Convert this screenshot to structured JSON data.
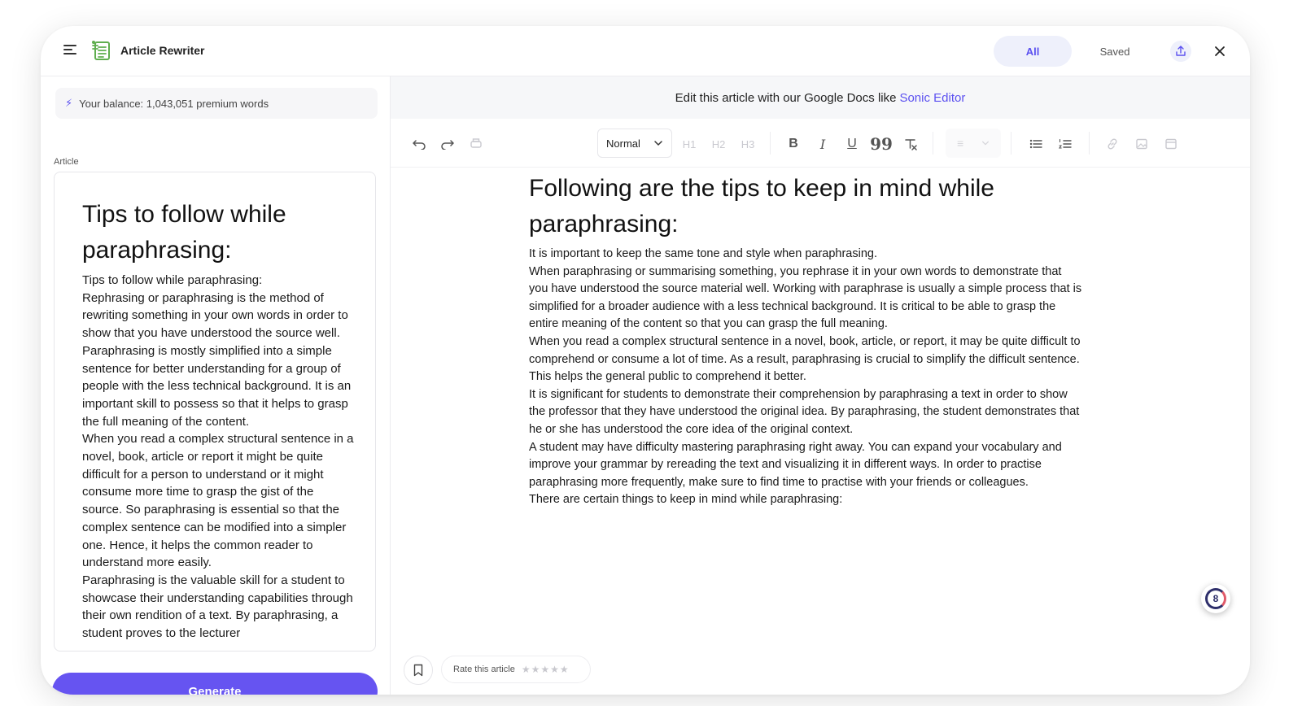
{
  "header": {
    "app_title": "Article Rewriter",
    "tabs": [
      {
        "label": "All",
        "active": true
      },
      {
        "label": "Saved",
        "active": false
      }
    ],
    "icons": [
      "menu-icon",
      "logo-icon",
      "share-icon",
      "close-icon"
    ]
  },
  "left": {
    "balance": "Your balance: 1,043,051 premium words",
    "article_label": "Article",
    "article": {
      "title": "Tips to follow while paraphrasing:",
      "paragraphs": [
        "Tips to follow while paraphrasing:",
        "Rephrasing or paraphrasing is the method of rewriting something in your own words in order to show that you have understood the source well. Paraphrasing is mostly simplified into a simple sentence for better understanding for a group of people with the less technical background. It is an important skill to possess so that it helps to grasp the full meaning of the content.",
        "When you read a complex structural sentence in a novel, book, article or report it might be quite difficult for a person to understand or it might consume more time to grasp the gist of the source. So paraphrasing is essential so that the complex sentence can be modified into a simpler one. Hence, it helps the common reader to understand more easily.",
        "Paraphrasing is the valuable skill for a student to showcase their understanding capabilities through their own rendition of a text. By paraphrasing, a student proves to the lecturer"
      ]
    },
    "generate_label": "Generate"
  },
  "editor": {
    "promo_text": "Edit this article with our Google Docs like",
    "promo_link": "Sonic Editor",
    "toolbar": {
      "style_value": "Normal",
      "h1": "H1",
      "h2": "H2",
      "h3": "H3"
    },
    "document": {
      "title": "Following are the tips to keep in mind while paraphrasing:",
      "paragraphs": [
        "It is important to keep the same tone and style when paraphrasing.",
        "When paraphrasing or summarising something, you rephrase it in your own words to demonstrate that you have understood the source material well. Working with paraphrase is usually a simple process that is simplified for a broader audience with a less technical background. It is critical to be able to grasp the entire meaning of the content so that you can grasp the full meaning.",
        "When you read a complex structural sentence in a novel, book, article, or report, it may be quite difficult to comprehend or consume a lot of time. As a result, paraphrasing is crucial to simplify the difficult sentence. This helps the general public to comprehend it better.",
        "It is significant for students to demonstrate their comprehension by paraphrasing a text in order to show the professor that they have understood the original idea. By paraphrasing, the student demonstrates that he or she has understood the core idea of the original context.",
        "A student may have difficulty mastering paraphrasing right away. You can expand your vocabulary and improve your grammar by rereading the text and visualizing it in different ways. In order to practise paraphrasing more frequently, make sure to find time to practise with your friends or colleagues.",
        "There are certain things to keep in mind while paraphrasing:"
      ]
    },
    "rate_label": "Rate this article",
    "badge_count": "8"
  },
  "colors": {
    "accent": "#6654f1",
    "tab_active_bg": "#eef0fb",
    "promo_bg": "#f6f7f9"
  }
}
